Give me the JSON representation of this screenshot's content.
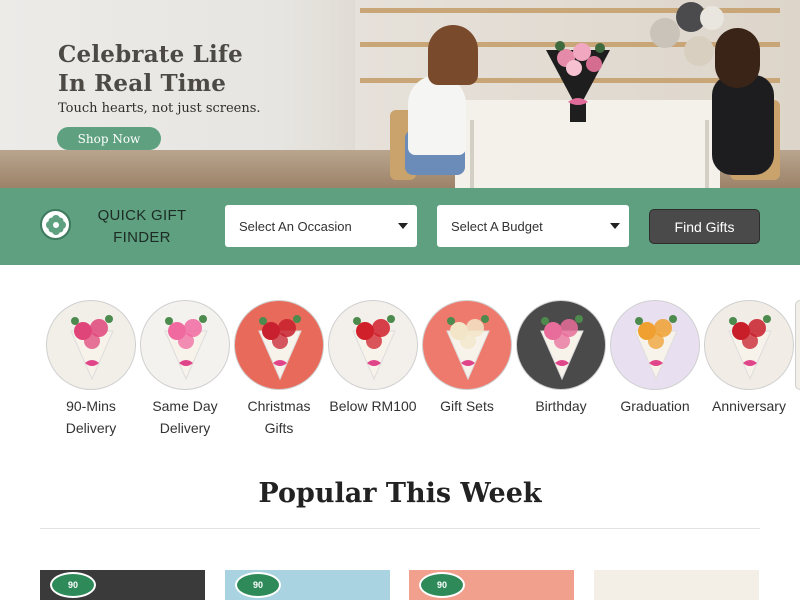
{
  "hero": {
    "title_line1": "Celebrate Life",
    "title_line2": "In Real Time",
    "subtitle": "Touch hearts, not just screens.",
    "cta_label": "Shop Now"
  },
  "finder": {
    "title_line1": "QUICK GIFT",
    "title_line2": "FINDER",
    "occasion_placeholder": "Select An Occasion",
    "budget_placeholder": "Select A Budget",
    "button_label": "Find Gifts",
    "icon": "flower-icon"
  },
  "categories": [
    {
      "line1": "90-Mins",
      "line2": "Delivery",
      "bg": "#f2efe9",
      "flower": "#e0457a"
    },
    {
      "line1": "Same Day",
      "line2": "Delivery",
      "bg": "#f4f2ee",
      "flower": "#f06aa0"
    },
    {
      "line1": "Christmas",
      "line2": "Gifts",
      "bg": "#e86a5a",
      "flower": "#c8202e"
    },
    {
      "line1": "Below RM100",
      "line2": "",
      "bg": "#f3f0eb",
      "flower": "#d0202a"
    },
    {
      "line1": "Gift Sets",
      "line2": "",
      "bg": "#ee7a6d",
      "flower": "#f3e5c8"
    },
    {
      "line1": "Birthday",
      "line2": "",
      "bg": "#4a4a4a",
      "flower": "#e86d9a"
    },
    {
      "line1": "Graduation",
      "line2": "",
      "bg": "#e8e0f0",
      "flower": "#f0a030"
    },
    {
      "line1": "Anniversary",
      "line2": "",
      "bg": "#f1ede6",
      "flower": "#c81e2a"
    }
  ],
  "popular": {
    "title": "Popular This Week",
    "cards": [
      {
        "bg": "#3a3a3a",
        "badge": "90"
      },
      {
        "bg": "#a9d3e0",
        "badge": "90"
      },
      {
        "bg": "#f0a08c",
        "badge": "90"
      },
      {
        "bg": "#f3efe6",
        "badge": ""
      }
    ]
  }
}
